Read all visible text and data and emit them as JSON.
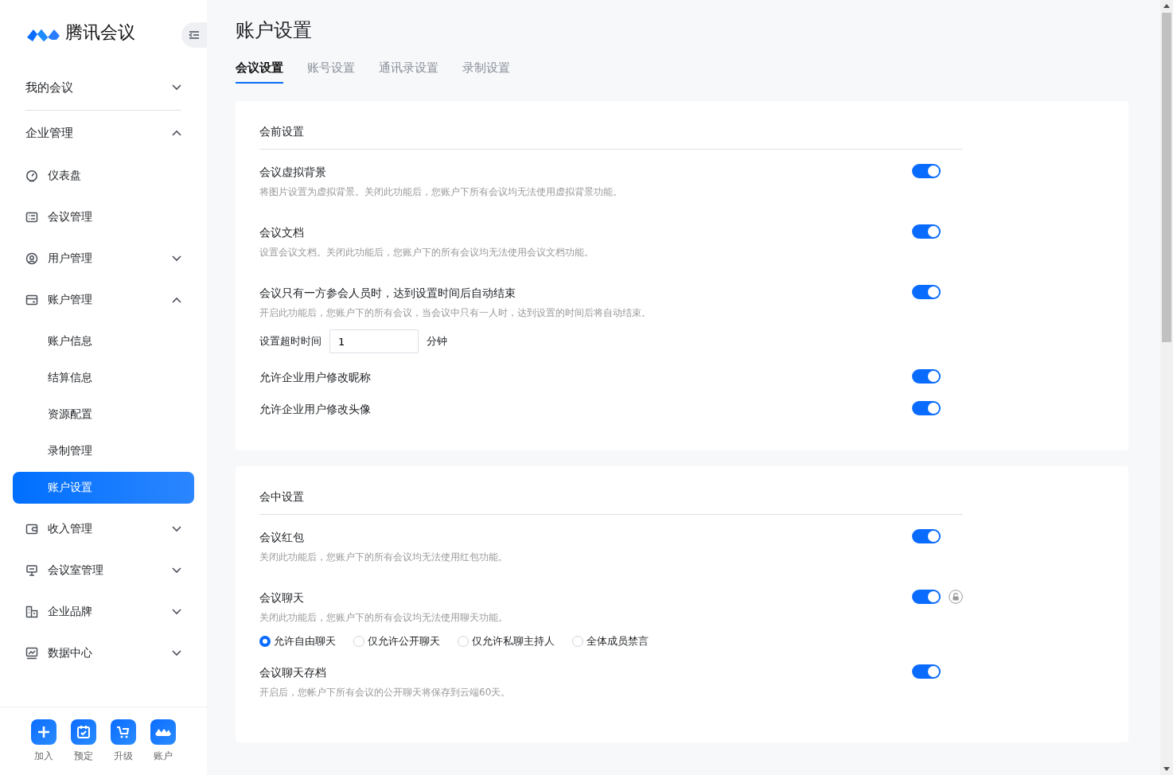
{
  "brand": {
    "name": "腾讯会议"
  },
  "sidebar": {
    "items": [
      {
        "label": "我的会议",
        "expanded": false,
        "selected": false
      },
      {
        "label": "企业管理",
        "expanded": true,
        "selected": false,
        "children": [
          {
            "label": "仪表盘",
            "selected": false
          },
          {
            "label": "会议管理",
            "selected": false
          },
          {
            "label": "用户管理",
            "expanded": false,
            "selected": false
          },
          {
            "label": "账户管理",
            "expanded": true,
            "selected": false,
            "children": [
              {
                "label": "账户信息",
                "selected": false
              },
              {
                "label": "结算信息",
                "selected": false
              },
              {
                "label": "资源配置",
                "selected": false
              },
              {
                "label": "录制管理",
                "selected": false
              },
              {
                "label": "账户设置",
                "selected": true
              }
            ]
          },
          {
            "label": "收入管理",
            "expanded": false,
            "selected": false
          },
          {
            "label": "会议室管理",
            "expanded": false,
            "selected": false
          },
          {
            "label": "企业品牌",
            "expanded": false,
            "selected": false
          },
          {
            "label": "数据中心",
            "expanded": false,
            "selected": false
          }
        ]
      }
    ]
  },
  "bottom_bar": [
    {
      "label": "加入"
    },
    {
      "label": "预定"
    },
    {
      "label": "升级"
    },
    {
      "label": "账户"
    }
  ],
  "page": {
    "title": "账户设置"
  },
  "tabs": [
    {
      "label": "会议设置",
      "selected": true
    },
    {
      "label": "账号设置",
      "selected": false
    },
    {
      "label": "通讯录设置",
      "selected": false
    },
    {
      "label": "录制设置",
      "selected": false
    }
  ],
  "sections": [
    {
      "title": "会前设置",
      "settings": [
        {
          "title": "会议虚拟背景",
          "description": "将图片设置为虚拟背景。关闭此功能后，您账户下所有会议均无法使用虚拟背景功能。",
          "on": true
        },
        {
          "title": "会议文档",
          "description": "设置会议文档。关闭此功能后，您账户下的所有会议均无法使用会议文档功能。",
          "on": true
        },
        {
          "title": "会议只有一方参会人员时，达到设置时间后自动结束",
          "description": "开启此功能后，您账户下的所有会议，当会议中只有一人时，达到设置的时间后将自动结束。",
          "on": true,
          "timeout": {
            "label": "设置超时时间",
            "value": "1",
            "unit": "分钟"
          }
        },
        {
          "title": "允许企业用户修改昵称",
          "on": true
        },
        {
          "title": "允许企业用户修改头像",
          "on": true
        }
      ]
    },
    {
      "title": "会中设置",
      "settings": [
        {
          "title": "会议红包",
          "description": "关闭此功能后，您账户下的所有会议均无法使用红包功能。",
          "on": true
        },
        {
          "title": "会议聊天",
          "description": "关闭此功能后，您账户下的所有会议均无法使用聊天功能。",
          "on": true,
          "locked": true,
          "options": [
            {
              "label": "允许自由聊天",
              "selected": true
            },
            {
              "label": "仅允许公开聊天",
              "selected": false
            },
            {
              "label": "仅允许私聊主持人",
              "selected": false
            },
            {
              "label": "全体成员禁言",
              "selected": false
            }
          ]
        },
        {
          "title": "会议聊天存档",
          "description": "开启后，您帐户下所有会议的公开聊天将保存到云端60天。",
          "on": true
        }
      ]
    }
  ]
}
